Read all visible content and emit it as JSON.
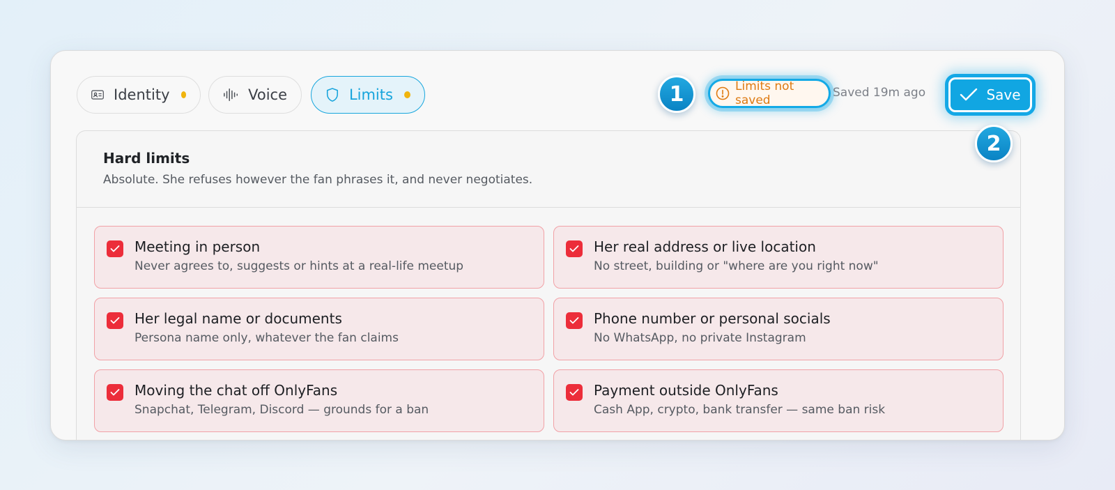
{
  "tabs": [
    {
      "label": "Identity",
      "icon": "id-card-icon",
      "unsaved": true
    },
    {
      "label": "Voice",
      "icon": "waveform-icon",
      "unsaved": false
    },
    {
      "label": "Limits",
      "icon": "shield-icon",
      "unsaved": true,
      "active": true
    }
  ],
  "steps": {
    "one": "1",
    "two": "2"
  },
  "status": {
    "warning_label": "Limits not saved",
    "warning_icon": "alert-circle-icon",
    "saved_ago": "Saved 19m ago"
  },
  "toolbar": {
    "save_label": "Save",
    "save_icon": "check-icon"
  },
  "section": {
    "title": "Hard limits",
    "subtitle": "Absolute. She refuses however the fan phrases it, and never negotiates."
  },
  "limits": [
    {
      "title": "Meeting in person",
      "desc": "Never agrees to, suggests or hints at a real-life meetup",
      "checked": true
    },
    {
      "title": "Her real address or live location",
      "desc": "No street, building or \"where are you right now\"",
      "checked": true
    },
    {
      "title": "Her legal name or documents",
      "desc": "Persona name only, whatever the fan claims",
      "checked": true
    },
    {
      "title": "Phone number or personal socials",
      "desc": "No WhatsApp, no private Instagram",
      "checked": true
    },
    {
      "title": "Moving the chat off OnlyFans",
      "desc": "Snapchat, Telegram, Discord — grounds for a ban",
      "checked": true
    },
    {
      "title": "Payment outside OnlyFans",
      "desc": "Cash App, crypto, bank transfer — same ban risk",
      "checked": true
    }
  ],
  "colors": {
    "accent": "#11a6e2",
    "warning": "#de7a12",
    "unsaved_dot": "#f0b40e",
    "limit_check": "#ec2d3a",
    "limit_bg": "#f6e8ea",
    "limit_border": "#f1a1a6"
  }
}
